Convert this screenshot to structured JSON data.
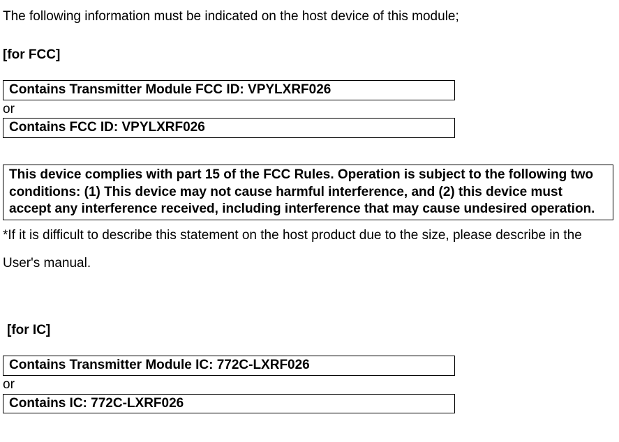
{
  "intro": "The following information must be indicated on the host device of this module;",
  "fcc": {
    "header": "[for FCC]",
    "box1": "Contains Transmitter Module FCC ID: VPYLXRF026",
    "or": "or",
    "box2": "Contains FCC ID: VPYLXRF026",
    "compliance": "This device complies with part 15 of the FCC Rules. Operation is subject to the following two conditions: (1) This device may not cause harmful interference, and (2) this device must accept any interference received, including interference that may cause undesired operation.",
    "note": "*If it is difficult to describe this statement on the host product due to the size, please describe in the User's manual."
  },
  "ic": {
    "header": "[for IC]",
    "box1": "Contains Transmitter Module IC: 772C-LXRF026",
    "or": "or",
    "box2": "Contains IC: 772C-LXRF026"
  }
}
